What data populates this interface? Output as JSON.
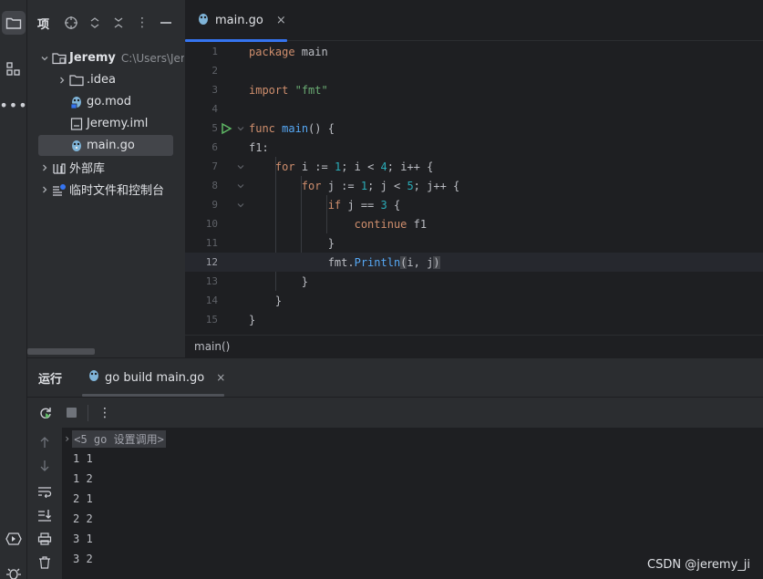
{
  "project_panel": {
    "title": "项",
    "tree": [
      {
        "label": "Jeremy",
        "path": "C:\\Users\\Jer",
        "expanded": true,
        "icon": "module-folder-icon"
      },
      {
        "label": ".idea",
        "icon": "folder-icon"
      },
      {
        "label": "go.mod",
        "icon": "gomod-file-icon"
      },
      {
        "label": "Jeremy.iml",
        "icon": "iml-file-icon"
      },
      {
        "label": "main.go",
        "icon": "go-file-icon",
        "selected": true
      },
      {
        "label": "外部库",
        "icon": "library-icon"
      },
      {
        "label": "临时文件和控制台",
        "icon": "scratches-icon"
      }
    ]
  },
  "editor": {
    "tab": {
      "name": "main.go",
      "close": "×"
    },
    "line_numbers": [
      "1",
      "2",
      "3",
      "4",
      "5",
      "6",
      "7",
      "8",
      "9",
      "10",
      "11",
      "12",
      "13",
      "14",
      "15"
    ],
    "current_line": 12,
    "breadcrumb": "main()"
  },
  "run_panel": {
    "title": "运行",
    "tab": {
      "name": "go build main.go",
      "close": "×"
    },
    "command_line": "<5 go 设置调用>",
    "output": [
      "1 1",
      "1 2",
      "2 1",
      "2 2",
      "3 1",
      "3 2"
    ]
  },
  "watermark": "CSDN @jeremy_ji",
  "colors": {
    "accent": "#3574f0",
    "keyword": "#cf8e6d",
    "function": "#56a8f5",
    "string": "#6aab73",
    "number": "#2aacb8",
    "run_icon": "#5fb865"
  }
}
